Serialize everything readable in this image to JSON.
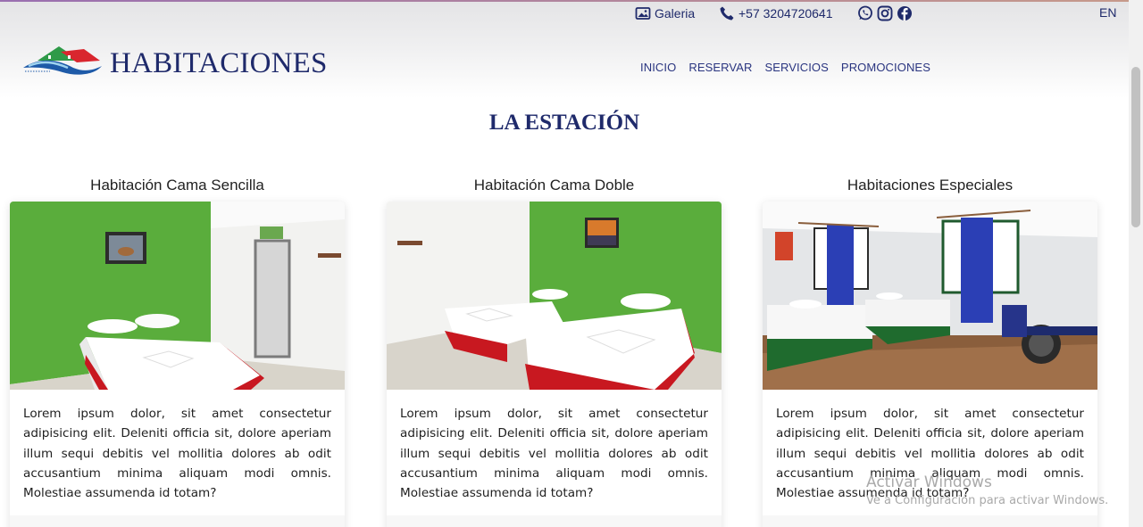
{
  "topbar": {
    "gallery_label": "Galeria",
    "phone": "+57 3204720641",
    "language": "EN"
  },
  "brand": {
    "name": "HABITACIONES"
  },
  "nav": {
    "items": [
      "INICIO",
      "RESERVAR",
      "SERVICIOS",
      "PROMOCIONES"
    ]
  },
  "section": {
    "title": "LA ESTACIÓN"
  },
  "cards": [
    {
      "title": "Habitación Cama Sencilla",
      "description": "Lorem ipsum dolor, sit amet consectetur adipisicing elit. Deleniti officia sit, dolore aperiam illum sequi debitis vel mollitia dolores ab odit accusantium minima aliquam modi omnis. Molestiae assumenda id totam?"
    },
    {
      "title": "Habitación Cama Doble",
      "description": "Lorem ipsum dolor, sit amet consectetur adipisicing elit. Deleniti officia sit, dolore aperiam illum sequi debitis vel mollitia dolores ab odit accusantium minima aliquam modi omnis. Molestiae assumenda id totam?"
    },
    {
      "title": "Habitaciones Especiales",
      "description": "Lorem ipsum dolor, sit amet consectetur adipisicing elit. Deleniti officia sit, dolore aperiam illum sequi debitis vel mollitia dolores ab odit accusantium minima aliquam modi omnis. Molestiae assumenda id totam?"
    }
  ],
  "watermark": {
    "line1": "Activar Windows",
    "line2": "Ve a Configuración para activar Windows."
  },
  "icons": {
    "gallery": "image-icon",
    "phone": "phone-icon",
    "whatsapp": "whatsapp-icon",
    "instagram": "instagram-icon",
    "facebook": "facebook-icon"
  },
  "colors": {
    "brand_navy": "#1f2a6b",
    "nav_blue": "#2a3580",
    "room_green": "#5aad3c",
    "bed_red": "#d0161e"
  }
}
